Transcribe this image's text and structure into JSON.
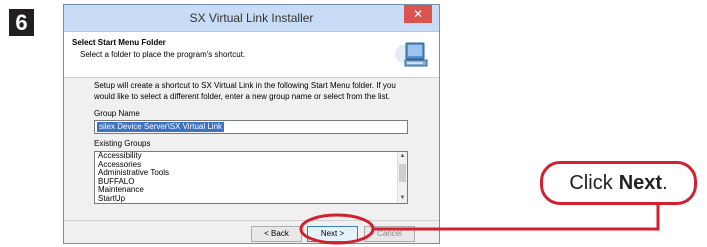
{
  "step": {
    "number": "6"
  },
  "window": {
    "title": "SX Virtual Link Installer",
    "close_label": "✕"
  },
  "header": {
    "title": "Select Start Menu Folder",
    "subtitle": "Select a folder to place the program's shortcut."
  },
  "body": {
    "description_line1": "Setup will create a shortcut to SX Virtual Link in the following Start Menu folder. If you",
    "description_line2": "would like to select a different folder, enter a new group name or select from the list.",
    "group_name_label": "Group Name",
    "group_name_value": "silex Device Server\\SX Virtual Link",
    "existing_groups_label": "Existing Groups",
    "existing_groups": [
      "Accessibility",
      "Accessories",
      "Administrative Tools",
      "BUFFALO",
      "Maintenance",
      "StartUp"
    ]
  },
  "buttons": {
    "back": "< Back",
    "next": "Next >",
    "cancel": "Cancel"
  },
  "callout": {
    "prefix": "Click",
    "action": "Next",
    "suffix": "."
  },
  "colors": {
    "highlight": "#d1202f",
    "selection": "#3b72c4"
  }
}
